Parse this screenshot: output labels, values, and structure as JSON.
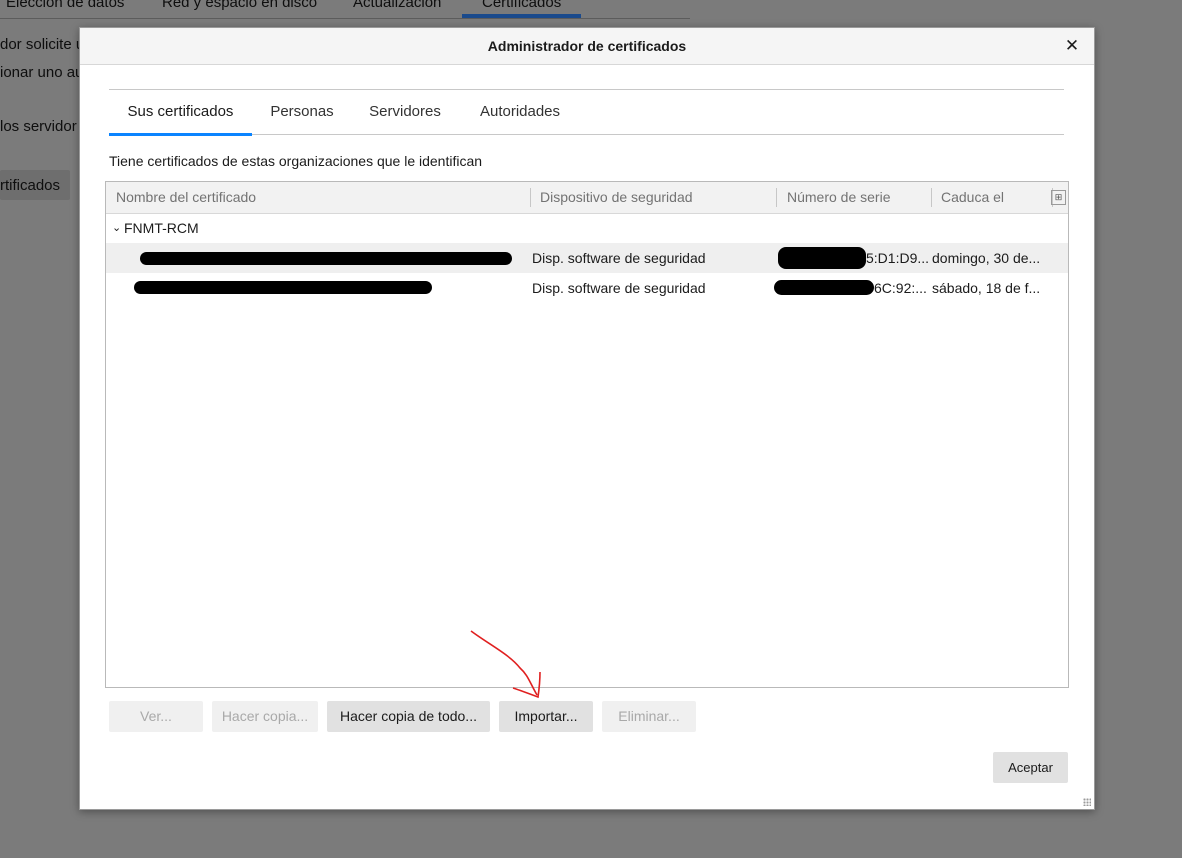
{
  "background": {
    "tabs": [
      "Elección de datos",
      "Red y espacio en disco",
      "Actualización",
      "Certificados"
    ],
    "text_lines": [
      "dor solicite u",
      "ionar uno au",
      "los servidor"
    ],
    "button_label": "rtificados"
  },
  "dialog": {
    "title": "Administrador de certificados",
    "close_glyph": "✕",
    "tabs": [
      "Sus certificados",
      "Personas",
      "Servidores",
      "Autoridades"
    ],
    "selected_tab": "Sus certificados",
    "info_text": "Tiene certificados de estas organizaciones que le identifican",
    "columns": {
      "name": "Nombre del certificado",
      "device": "Dispositivo de seguridad",
      "serial": "Número de serie",
      "expires": "Caduca el"
    },
    "group": {
      "chevron": "⌄",
      "name": "FNMT-RCM"
    },
    "rows": [
      {
        "device": "Disp. software de seguridad",
        "serial": "5:D1:D9...",
        "expires": "domingo, 30 de..."
      },
      {
        "device": "Disp. software de seguridad",
        "serial": "6C:92:...",
        "expires": "sábado, 18 de f..."
      }
    ],
    "buttons": {
      "ver": "Ver...",
      "hacer_copia": "Hacer copia...",
      "hacer_copia_todo": "Hacer copia de todo...",
      "importar": "Importar...",
      "eliminar": "Eliminar...",
      "aceptar": "Aceptar"
    }
  },
  "colors": {
    "tab_accent": "#0a84ff",
    "annotation_arrow": "#e02020"
  }
}
